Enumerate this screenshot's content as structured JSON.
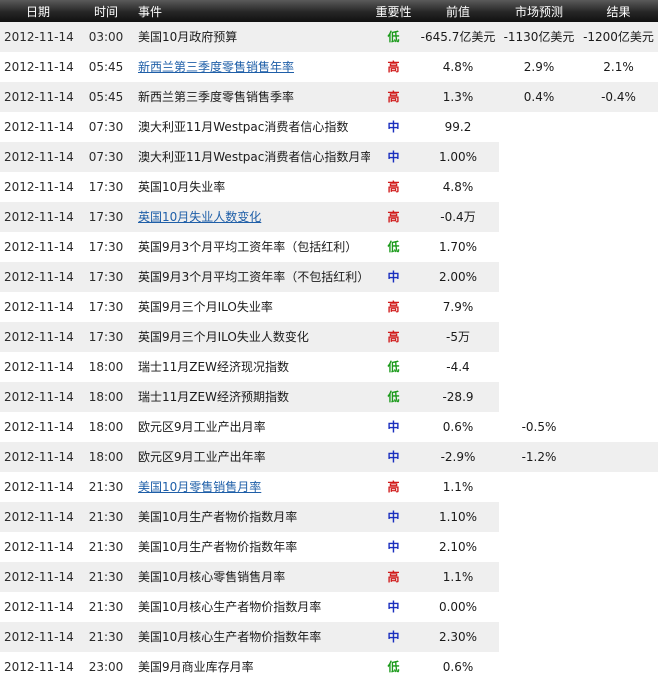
{
  "header": {
    "date": "日期",
    "time": "时间",
    "event": "事件",
    "importance": "重要性",
    "previous": "前值",
    "forecast": "市场预测",
    "result": "结果"
  },
  "colors": {
    "low": "#1a9a1a",
    "high": "#d01a1a",
    "mid": "#1a2fbf",
    "link": "#1f5fa8"
  },
  "rows": [
    {
      "date": "2012-11-14",
      "time": "03:00",
      "event": "美国10月政府预算",
      "link": false,
      "importance": "低",
      "level": "low",
      "previous": "-645.7亿美元",
      "forecast": "-1130亿美元",
      "result": "-1200亿美元"
    },
    {
      "date": "2012-11-14",
      "time": "05:45",
      "event": "新西兰第三季度零售销售年率",
      "link": true,
      "importance": "高",
      "level": "high",
      "previous": "4.8%",
      "forecast": "2.9%",
      "result": "2.1%"
    },
    {
      "date": "2012-11-14",
      "time": "05:45",
      "event": "新西兰第三季度零售销售季率",
      "link": false,
      "importance": "高",
      "level": "high",
      "previous": "1.3%",
      "forecast": "0.4%",
      "result": "-0.4%"
    },
    {
      "date": "2012-11-14",
      "time": "07:30",
      "event": "澳大利亚11月Westpac消费者信心指数",
      "link": false,
      "importance": "中",
      "level": "mid",
      "previous": "99.2",
      "forecast": "",
      "result": ""
    },
    {
      "date": "2012-11-14",
      "time": "07:30",
      "event": "澳大利亚11月Westpac消费者信心指数月率",
      "link": false,
      "importance": "中",
      "level": "mid",
      "previous": "1.00%",
      "forecast": "",
      "result": ""
    },
    {
      "date": "2012-11-14",
      "time": "17:30",
      "event": "英国10月失业率",
      "link": false,
      "importance": "高",
      "level": "high",
      "previous": "4.8%",
      "forecast": "",
      "result": ""
    },
    {
      "date": "2012-11-14",
      "time": "17:30",
      "event": "英国10月失业人数变化",
      "link": true,
      "importance": "高",
      "level": "high",
      "previous": "-0.4万",
      "forecast": "",
      "result": ""
    },
    {
      "date": "2012-11-14",
      "time": "17:30",
      "event": "英国9月3个月平均工资年率（包括红利）",
      "link": false,
      "importance": "低",
      "level": "low",
      "previous": "1.70%",
      "forecast": "",
      "result": ""
    },
    {
      "date": "2012-11-14",
      "time": "17:30",
      "event": "英国9月3个月平均工资年率（不包括红利）",
      "link": false,
      "importance": "中",
      "level": "mid",
      "previous": "2.00%",
      "forecast": "",
      "result": ""
    },
    {
      "date": "2012-11-14",
      "time": "17:30",
      "event": "英国9月三个月ILO失业率",
      "link": false,
      "importance": "高",
      "level": "high",
      "previous": "7.9%",
      "forecast": "",
      "result": ""
    },
    {
      "date": "2012-11-14",
      "time": "17:30",
      "event": "英国9月三个月ILO失业人数变化",
      "link": false,
      "importance": "高",
      "level": "high",
      "previous": "-5万",
      "forecast": "",
      "result": ""
    },
    {
      "date": "2012-11-14",
      "time": "18:00",
      "event": "瑞士11月ZEW经济现况指数",
      "link": false,
      "importance": "低",
      "level": "low",
      "previous": "-4.4",
      "forecast": "",
      "result": ""
    },
    {
      "date": "2012-11-14",
      "time": "18:00",
      "event": "瑞士11月ZEW经济预期指数",
      "link": false,
      "importance": "低",
      "level": "low",
      "previous": "-28.9",
      "forecast": "",
      "result": ""
    },
    {
      "date": "2012-11-14",
      "time": "18:00",
      "event": "欧元区9月工业产出月率",
      "link": false,
      "importance": "中",
      "level": "mid",
      "previous": "0.6%",
      "forecast": "-0.5%",
      "result": ""
    },
    {
      "date": "2012-11-14",
      "time": "18:00",
      "event": "欧元区9月工业产出年率",
      "link": false,
      "importance": "中",
      "level": "mid",
      "previous": "-2.9%",
      "forecast": "-1.2%",
      "result": ""
    },
    {
      "date": "2012-11-14",
      "time": "21:30",
      "event": "美国10月零售销售月率",
      "link": true,
      "importance": "高",
      "level": "high",
      "previous": "1.1%",
      "forecast": "",
      "result": ""
    },
    {
      "date": "2012-11-14",
      "time": "21:30",
      "event": "美国10月生产者物价指数月率",
      "link": false,
      "importance": "中",
      "level": "mid",
      "previous": "1.10%",
      "forecast": "",
      "result": ""
    },
    {
      "date": "2012-11-14",
      "time": "21:30",
      "event": "美国10月生产者物价指数年率",
      "link": false,
      "importance": "中",
      "level": "mid",
      "previous": "2.10%",
      "forecast": "",
      "result": ""
    },
    {
      "date": "2012-11-14",
      "time": "21:30",
      "event": "美国10月核心零售销售月率",
      "link": false,
      "importance": "高",
      "level": "high",
      "previous": "1.1%",
      "forecast": "",
      "result": ""
    },
    {
      "date": "2012-11-14",
      "time": "21:30",
      "event": "美国10月核心生产者物价指数月率",
      "link": false,
      "importance": "中",
      "level": "mid",
      "previous": "0.00%",
      "forecast": "",
      "result": ""
    },
    {
      "date": "2012-11-14",
      "time": "21:30",
      "event": "美国10月核心生产者物价指数年率",
      "link": false,
      "importance": "中",
      "level": "mid",
      "previous": "2.30%",
      "forecast": "",
      "result": ""
    },
    {
      "date": "2012-11-14",
      "time": "23:00",
      "event": "美国9月商业库存月率",
      "link": false,
      "importance": "低",
      "level": "low",
      "previous": "0.6%",
      "forecast": "",
      "result": ""
    }
  ]
}
